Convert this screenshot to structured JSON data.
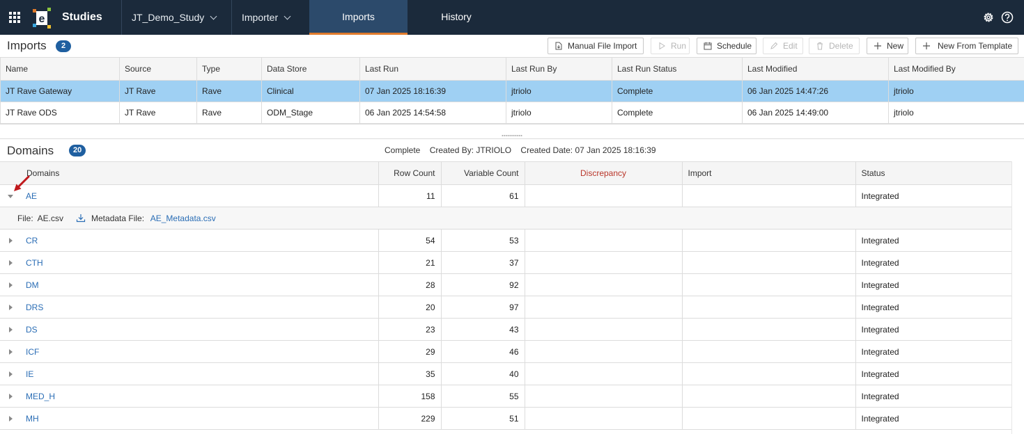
{
  "topbar": {
    "app_title": "Studies",
    "study_dropdown": "JT_Demo_Study",
    "module_dropdown": "Importer",
    "tabs": [
      {
        "label": "Imports",
        "active": true
      },
      {
        "label": "History",
        "active": false
      }
    ],
    "icons": [
      "apps-grid-icon",
      "app-logo",
      "settings-icon",
      "help-icon"
    ],
    "accent_color": "#e07b2c",
    "bar_color": "#1b2a3b"
  },
  "imports": {
    "title": "Imports",
    "count": "2",
    "toolbar": {
      "manual_file_import": "Manual File Import",
      "run": "Run",
      "schedule": "Schedule",
      "edit": "Edit",
      "delete": "Delete",
      "new": "New",
      "new_from_template": "New From Template"
    },
    "columns": [
      "Name",
      "Source",
      "Type",
      "Data Store",
      "Last Run",
      "Last Run By",
      "Last Run Status",
      "Last Modified",
      "Last Modified By"
    ],
    "rows": [
      [
        "JT Rave Gateway",
        "JT Rave",
        "Rave",
        "Clinical",
        "07 Jan 2025 18:16:39",
        "jtriolo",
        "Complete",
        "06 Jan 2025 14:47:26",
        "jtriolo"
      ],
      [
        "JT Rave ODS",
        "JT Rave",
        "Rave",
        "ODM_Stage",
        "06 Jan 2025 14:54:58",
        "jtriolo",
        "Complete",
        "06 Jan 2025 14:49:00",
        "jtriolo"
      ]
    ],
    "selected_row": 0,
    "selected_color": "#9fd0f3"
  },
  "domains": {
    "title": "Domains",
    "count": "20",
    "info": {
      "status": "Complete",
      "created_by": "Created By: JTRIOLO",
      "created_date": "Created Date: 07 Jan 2025 18:16:39"
    },
    "columns": {
      "domains": "Domains",
      "row_count": "Row Count",
      "variable_count": "Variable Count",
      "discrepancy": "Discrepancy",
      "import": "Import",
      "status": "Status"
    },
    "expanded": {
      "file_label": "File:",
      "file_value": "AE.csv",
      "metadata_label": "Metadata File:",
      "metadata_value": "AE_Metadata.csv"
    },
    "rows": [
      {
        "name": "AE",
        "row_count": "11",
        "variable_count": "61",
        "discrepancy": "",
        "import": "",
        "status": "Integrated",
        "expanded": true
      },
      {
        "name": "CR",
        "row_count": "54",
        "variable_count": "53",
        "discrepancy": "",
        "import": "",
        "status": "Integrated"
      },
      {
        "name": "CTH",
        "row_count": "21",
        "variable_count": "37",
        "discrepancy": "",
        "import": "",
        "status": "Integrated"
      },
      {
        "name": "DM",
        "row_count": "28",
        "variable_count": "92",
        "discrepancy": "",
        "import": "",
        "status": "Integrated"
      },
      {
        "name": "DRS",
        "row_count": "20",
        "variable_count": "97",
        "discrepancy": "",
        "import": "",
        "status": "Integrated"
      },
      {
        "name": "DS",
        "row_count": "23",
        "variable_count": "43",
        "discrepancy": "",
        "import": "",
        "status": "Integrated"
      },
      {
        "name": "ICF",
        "row_count": "29",
        "variable_count": "46",
        "discrepancy": "",
        "import": "",
        "status": "Integrated"
      },
      {
        "name": "IE",
        "row_count": "35",
        "variable_count": "40",
        "discrepancy": "",
        "import": "",
        "status": "Integrated"
      },
      {
        "name": "MED_H",
        "row_count": "158",
        "variable_count": "55",
        "discrepancy": "",
        "import": "",
        "status": "Integrated"
      },
      {
        "name": "MH",
        "row_count": "229",
        "variable_count": "51",
        "discrepancy": "",
        "import": "",
        "status": "Integrated"
      }
    ],
    "link_color": "#2a6db5",
    "discrepancy_color": "#b9362a"
  },
  "annotation": {
    "icon": "red-arrow-icon",
    "color": "#c0181c"
  }
}
